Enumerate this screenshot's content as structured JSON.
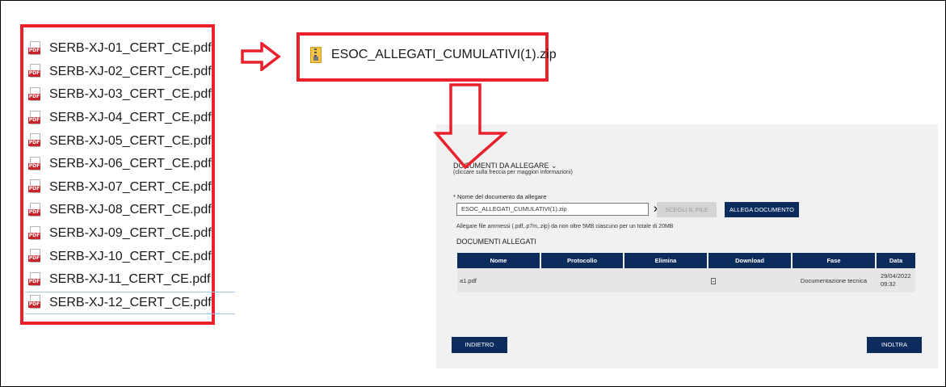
{
  "files": [
    {
      "name": "SERB-XJ-01_CERT_CE.pdf",
      "icon": "pdf-icon"
    },
    {
      "name": "SERB-XJ-02_CERT_CE.pdf",
      "icon": "pdf-icon"
    },
    {
      "name": "SERB-XJ-03_CERT_CE.pdf",
      "icon": "pdf-icon"
    },
    {
      "name": "SERB-XJ-04_CERT_CE.pdf",
      "icon": "pdf-icon"
    },
    {
      "name": "SERB-XJ-05_CERT_CE.pdf",
      "icon": "pdf-icon"
    },
    {
      "name": "SERB-XJ-06_CERT_CE.pdf",
      "icon": "pdf-icon"
    },
    {
      "name": "SERB-XJ-07_CERT_CE.pdf",
      "icon": "pdf-icon"
    },
    {
      "name": "SERB-XJ-08_CERT_CE.pdf",
      "icon": "pdf-icon"
    },
    {
      "name": "SERB-XJ-09_CERT_CE.pdf",
      "icon": "pdf-icon"
    },
    {
      "name": "SERB-XJ-10_CERT_CE.pdf",
      "icon": "pdf-icon"
    },
    {
      "name": "SERB-XJ-11_CERT_CE.pdf",
      "icon": "pdf-icon"
    },
    {
      "name": "SERB-XJ-12_CERT_CE.pdf",
      "icon": "pdf-icon"
    }
  ],
  "pdf_tag": "PDF",
  "zip": {
    "name": "ESOC_ALLEGATI_CUMULATIVI(1).zip",
    "icon": "zip-archive-icon"
  },
  "highlight_color": "#e8212b",
  "form": {
    "title": "DOCUMENTI DA ALLEGARE ⌄",
    "subtitle": "(cliccare sulla freccia per maggiori informazioni)",
    "field_label": "* Nome del documento da allegare",
    "field_value": "ESOC_ALLEGATI_CUMULATIVI(1).zip",
    "clear_glyph": "✕",
    "choose_label": "SCEGLI IL FILE",
    "attach_label": "ALLEGA DOCUMENTO",
    "note": "Allegare file ammessi (.pdf,.p7m,.zip) da non oltre 5MB ciascuno per un totale di 20MB",
    "docs_title": "DOCUMENTI ALLEGATI",
    "table": {
      "headers": [
        "Nome",
        "Protocollo",
        "Elimina",
        "Download",
        "Fase",
        "Data"
      ],
      "rows": [
        {
          "nome": "a1.pdf",
          "protocollo": "",
          "elimina": "",
          "download_icon": "document-download-icon",
          "fase": "Documentazione tecnica",
          "data_date": "29/04/2022",
          "data_time": "09:32"
        }
      ]
    },
    "back_label": "INDIETRO",
    "forward_label": "INOLTRA",
    "accent_color": "#0b2c5d"
  }
}
